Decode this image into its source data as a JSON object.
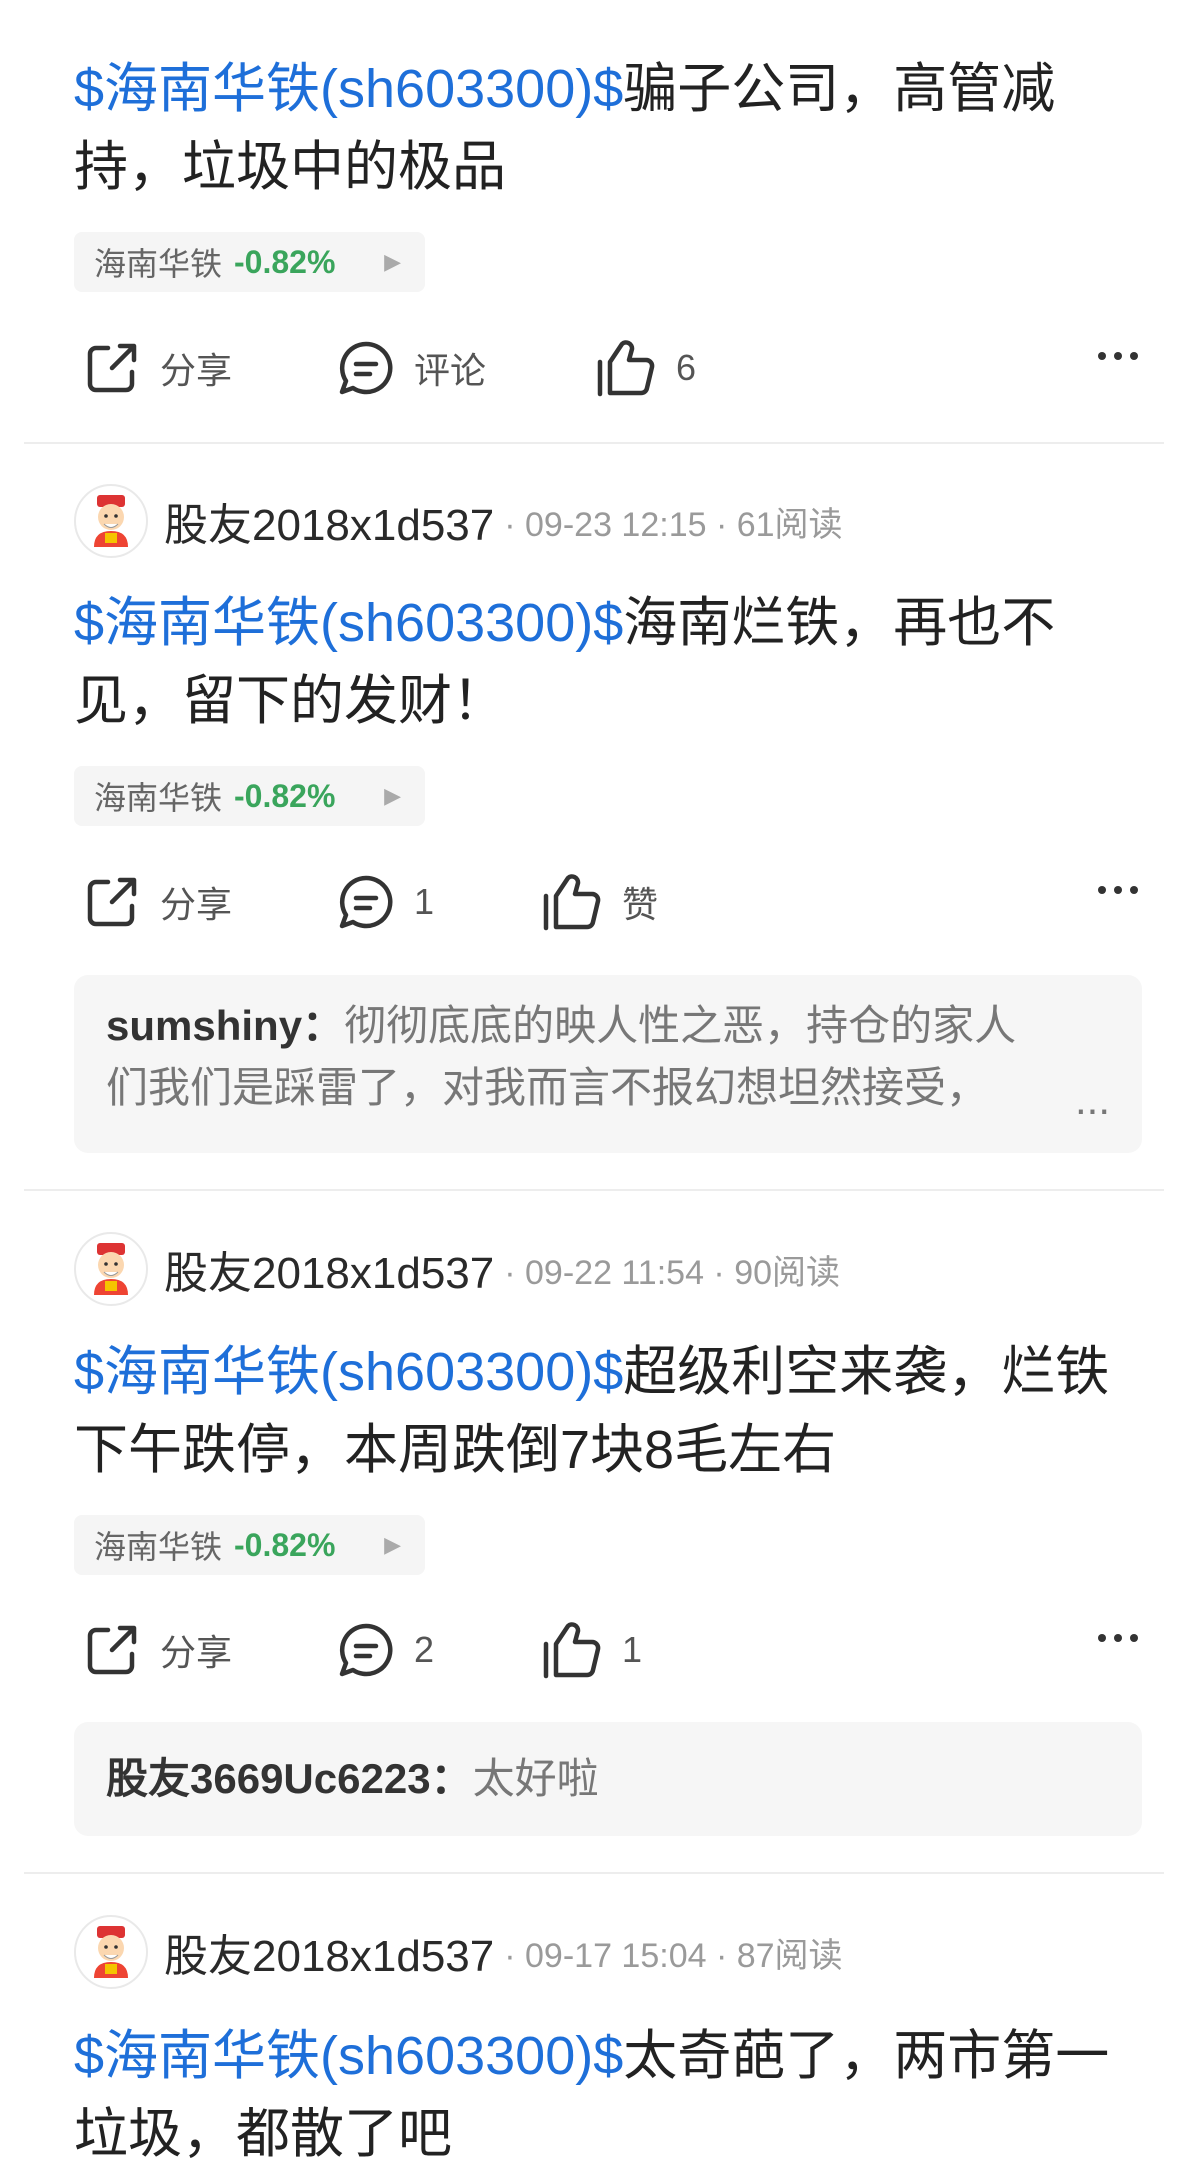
{
  "ui": {
    "share_label": "分享"
  },
  "posts": [
    {
      "stock_link": "$海南华铁(sh603300)$",
      "text_line1": "骗子公司，高管减",
      "text_line2": "持，垃圾中的极品",
      "tag": {
        "name": "海南华铁",
        "change": "-0.82%"
      },
      "comment_label": "评论",
      "like_label": "6"
    },
    {
      "user": "股友2018x1d537",
      "meta": "· 09-23 12:15 · 61阅读",
      "stock_link": "$海南华铁(sh603300)$",
      "text_line1": "海南烂铁，再也不",
      "text_line2": "见，留下的发财！",
      "tag": {
        "name": "海南华铁",
        "change": "-0.82%"
      },
      "comment_label": "1",
      "like_label": "赞",
      "top_comment": {
        "author": "sumshiny：",
        "text_line1": "彻彻底底的映人性之恶，持仓的家人",
        "text_line2": "们我们是踩雷了，对我而言不报幻想坦然接受，",
        "more": "..."
      }
    },
    {
      "user": "股友2018x1d537",
      "meta": "· 09-22 11:54 · 90阅读",
      "stock_link": "$海南华铁(sh603300)$",
      "text_line1": "超级利空来袭，烂铁",
      "text_line2": "下午跌停，本周跌倒7块8毛左右",
      "tag": {
        "name": "海南华铁",
        "change": "-0.82%"
      },
      "comment_label": "2",
      "like_label": "1",
      "top_comment": {
        "author": "股友3669Uc6223：",
        "text": "太好啦"
      }
    },
    {
      "user": "股友2018x1d537",
      "meta": "· 09-17 15:04 · 87阅读",
      "stock_link": "$海南华铁(sh603300)$",
      "text_line1": "太奇葩了，两市第一",
      "text_line2": "垃圾，都散了吧"
    }
  ],
  "colors": {
    "link": "#1e6fd9",
    "down": "#3aa55c"
  },
  "icons": [
    "share-icon",
    "comment-icon",
    "like-icon",
    "more-icon",
    "avatar-icon"
  ]
}
